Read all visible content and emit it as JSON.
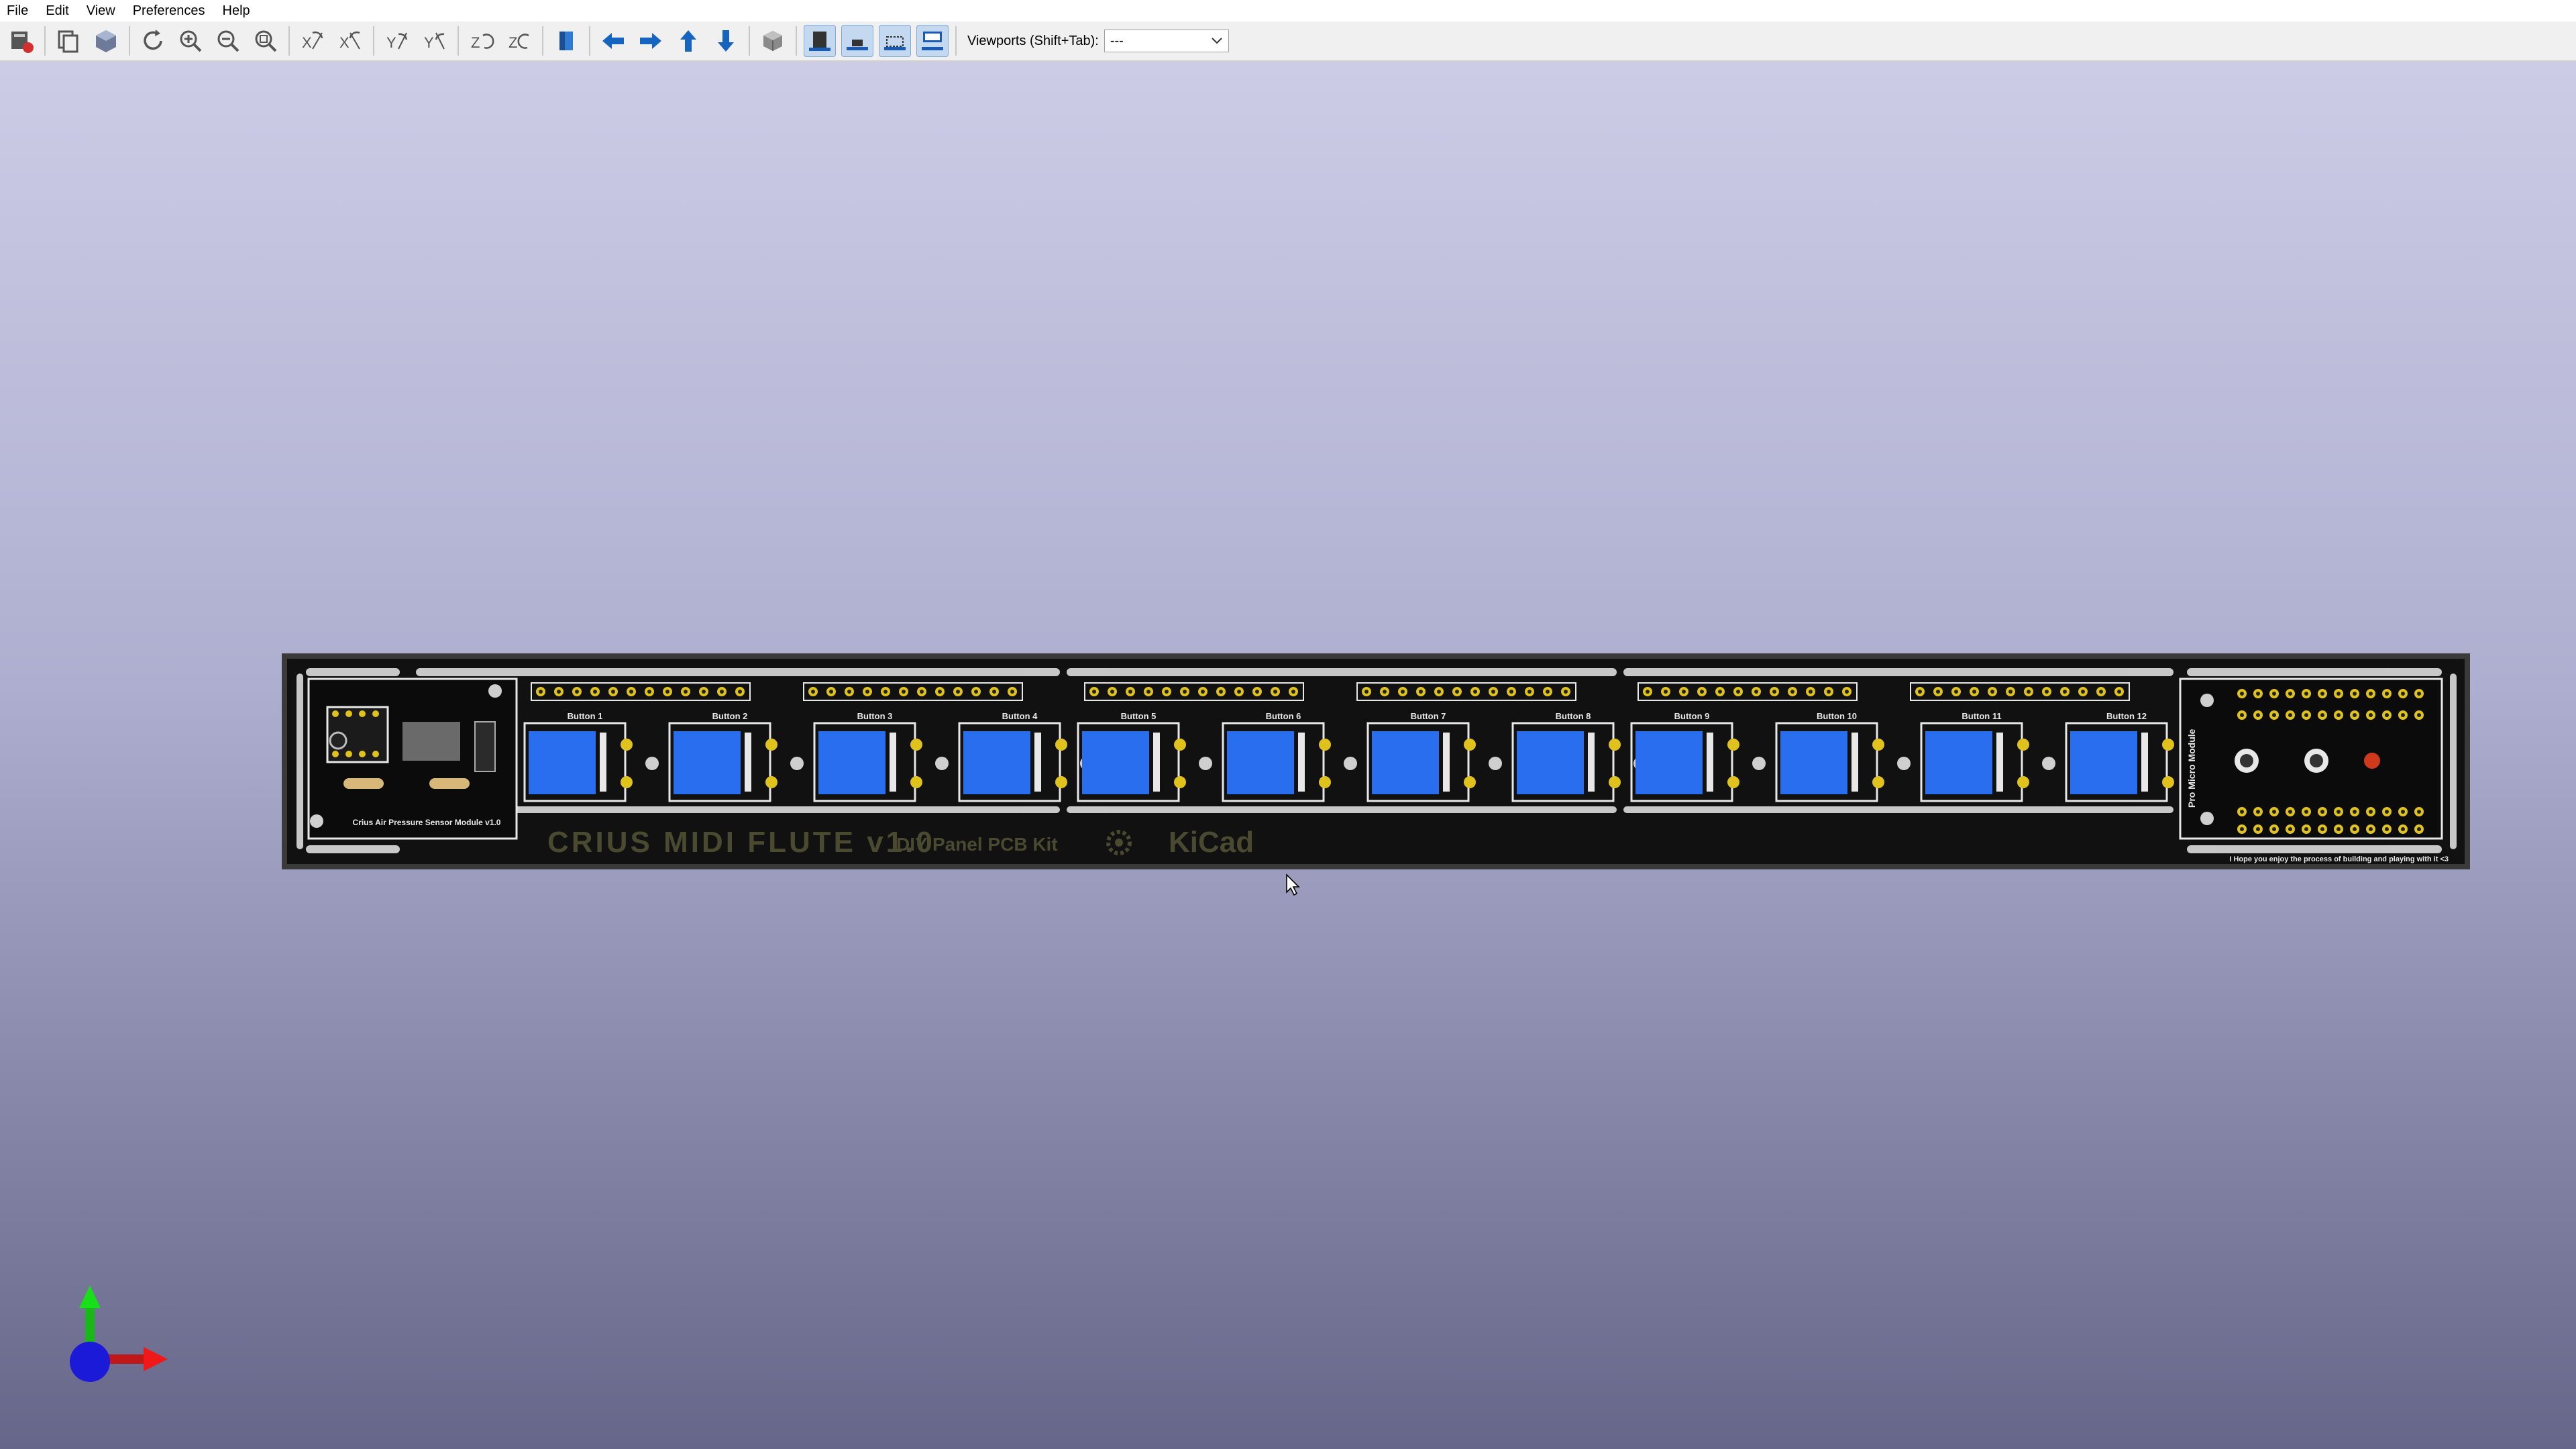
{
  "menubar": {
    "items": [
      "File",
      "Edit",
      "View",
      "Preferences",
      "Help"
    ]
  },
  "toolbar": {
    "buttons": [
      "reload-board-icon",
      "copy-image-icon",
      "render-3d-icon",
      "refresh-icon",
      "zoom-in-icon",
      "zoom-out-icon",
      "zoom-fit-icon",
      "rotate-x-cw-icon",
      "rotate-x-ccw-icon",
      "rotate-y-cw-icon",
      "rotate-y-ccw-icon",
      "rotate-z-cw-icon",
      "rotate-z-ccw-icon",
      "flip-board-icon",
      "move-left-icon",
      "move-right-icon",
      "move-up-icon",
      "move-down-icon",
      "ortho-toggle-icon",
      "show-body-icon",
      "show-smd-icon",
      "show-virtual-icon",
      "show-tht-icon"
    ],
    "viewports_label": "Viewports (Shift+Tab):",
    "viewports_value": "---"
  },
  "pcb": {
    "title": "CRIUS MIDI FLUTE v1.0",
    "subtitle": "DIY Panel PCB Kit",
    "kicad_logo": "KiCad",
    "sensor_label": "Crius Air Pressure Sensor Module v1.0",
    "promicro_label": "Pro Micro Module",
    "footer_note": "I Hope you enjoy the process of building and playing with it <3",
    "buttons": [
      "Button 1",
      "Button 2",
      "Button 3",
      "Button 4",
      "Button 5",
      "Button 6",
      "Button 7",
      "Button 8",
      "Button 9",
      "Button 10",
      "Button 11",
      "Button 12"
    ]
  },
  "colors": {
    "board": "#111111",
    "silk": "#e8e8e8",
    "pad": "#e0c21c",
    "switch_cap": "#2a6ef0",
    "canvas_top": "#cccce6",
    "canvas_bottom": "#666689",
    "accent": "#0078d7"
  }
}
